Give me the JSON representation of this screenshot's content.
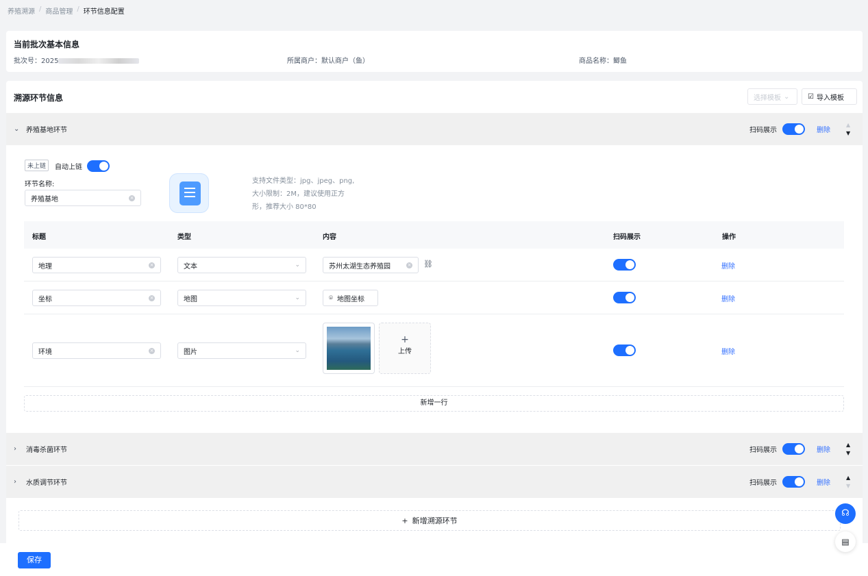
{
  "breadcrumb": {
    "items": [
      "养殖溯源",
      "商品管理",
      "环节信息配置"
    ]
  },
  "basic": {
    "title": "当前批次基本信息",
    "batch_label": "批次号：",
    "batch_prefix": "2025",
    "merchant": "所属商户：默认商户（鱼）",
    "product": "商品名称：鲫鱼"
  },
  "trace": {
    "title": "溯源环节信息",
    "select_template": "选择模板",
    "import_template": "导入模板"
  },
  "sections": [
    {
      "name": "养殖基地环节",
      "scan_label": "扫码展示",
      "scan_on": true,
      "delete": "删除",
      "expanded": true
    },
    {
      "name": "消毒杀菌环节",
      "scan_label": "扫码展示",
      "scan_on": true,
      "delete": "删除",
      "expanded": false
    },
    {
      "name": "水质调节环节",
      "scan_label": "扫码展示",
      "scan_on": true,
      "delete": "删除",
      "expanded": false
    }
  ],
  "panel": {
    "chain_tag": "未上链",
    "auto_chain": "自动上链",
    "auto_chain_on": true,
    "name_label": "环节名称:",
    "name_value": "养殖基地",
    "hint_lines": [
      "支持文件类型：jpg、jpeg、png,",
      "大小限制：2M，建议使用正方",
      "形，推荐大小 80*80"
    ],
    "headers": [
      "标题",
      "类型",
      "内容",
      "扫码展示",
      "操作"
    ],
    "rows": [
      {
        "title": "地理",
        "type": "文本",
        "content": "苏州太湖生态养殖园",
        "scan_on": true,
        "action": "删除"
      },
      {
        "title": "坐标",
        "type": "地图",
        "content": "地图坐标",
        "scan_on": true,
        "action": "删除"
      },
      {
        "title": "环境",
        "type": "图片",
        "content": "上传",
        "scan_on": true,
        "action": "删除"
      }
    ],
    "add_row": "新增一行"
  },
  "add_section": "新增溯源环节",
  "save": "保存",
  "colors": {
    "primary": "#1e6fff",
    "link": "#3370ff"
  }
}
